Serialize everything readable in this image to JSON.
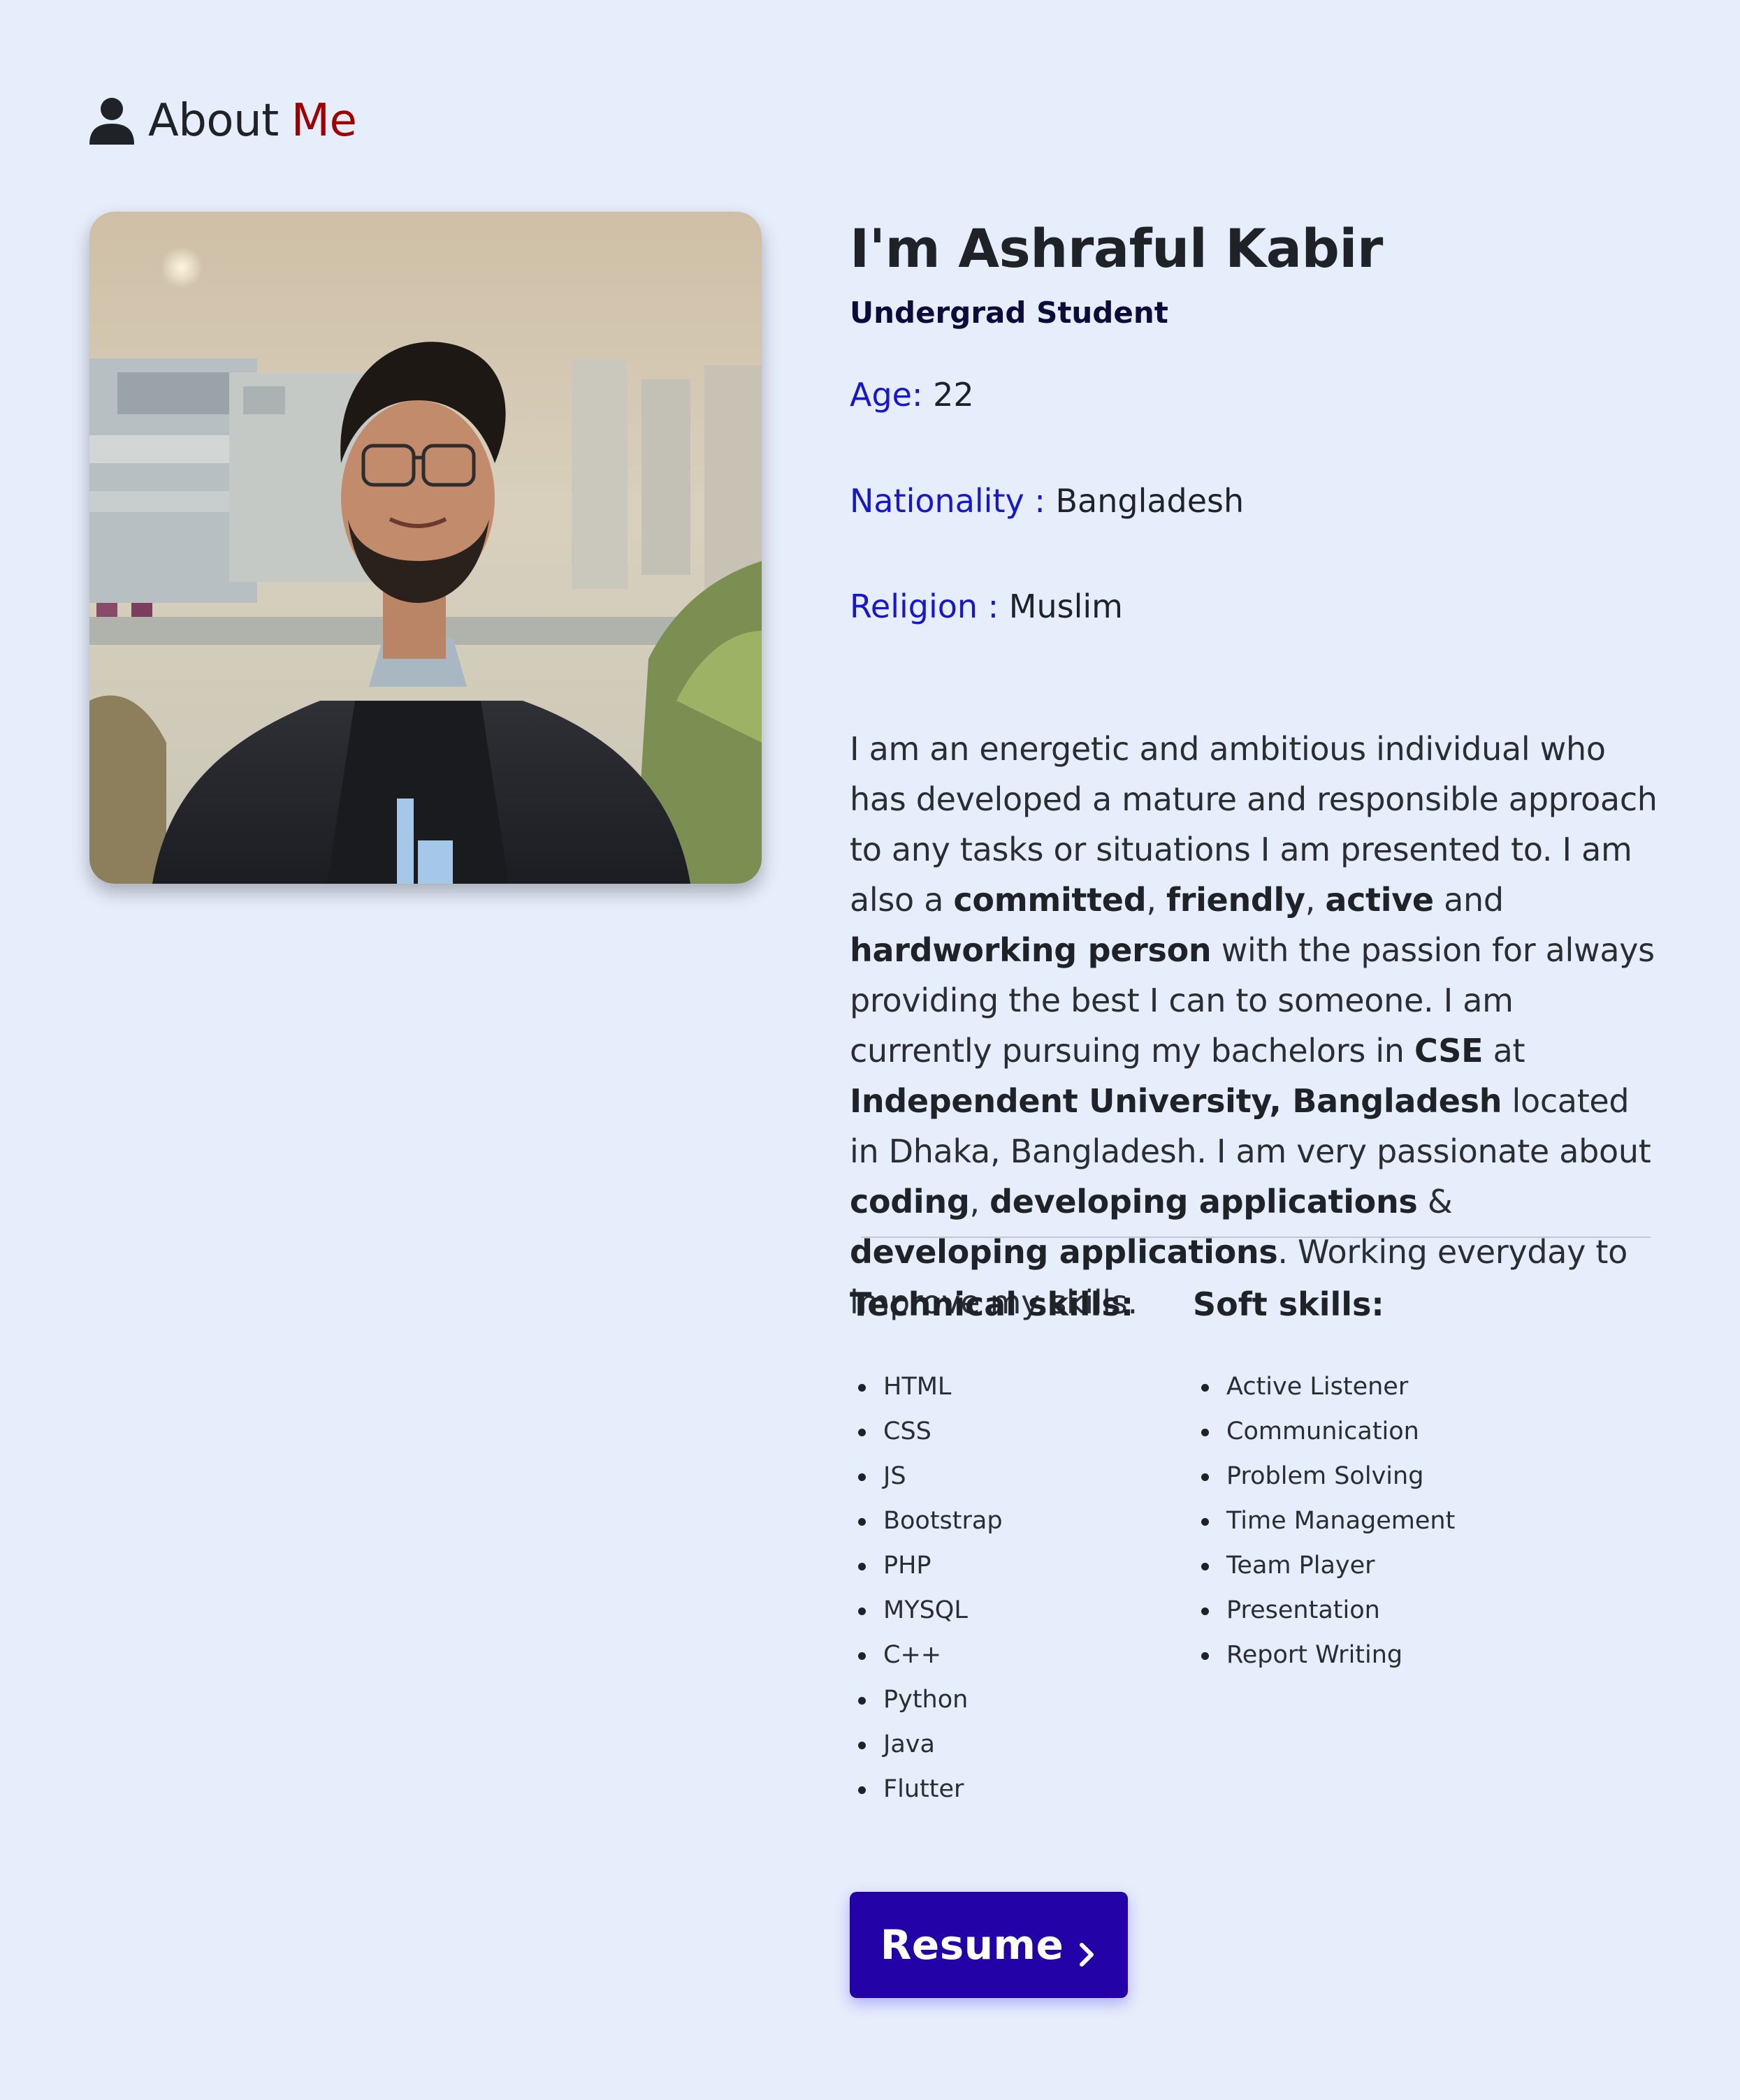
{
  "heading": {
    "icon": "user-icon",
    "about": "About",
    "me": "Me",
    "accent_color": "#a00000"
  },
  "profile": {
    "photo_alt": "profile-photo",
    "name": "I'm Ashraful Kabir",
    "subtitle": "Undergrad Student",
    "age_label": "Age:",
    "age_value": "22",
    "nationality_label": "Nationality :",
    "nationality_value": "Bangladesh",
    "religion_label": "Religion :",
    "religion_value": "Muslim",
    "label_color": "#1616d0"
  },
  "bio": {
    "p1": "I am an energetic and ambitious individual who has developed a mature and responsible approach to any tasks or situations I am presented to. I am also a ",
    "b1": "committed",
    "p2": ", ",
    "b2": "friendly",
    "p3": ", ",
    "b3": "active",
    "p4": " and ",
    "b4": "hardworking person",
    "p5": " with the passion for always providing the best I can to someone. I am currently pursuing my bachelors in ",
    "b5": "CSE",
    "p6": " at ",
    "b6": "Independent University, Bangladesh",
    "p7": " located in Dhaka, Bangladesh. I am very passionate about ",
    "b7": "coding",
    "p8": ", ",
    "b8": "developing applications",
    "p9": " & ",
    "b9": "developing applications",
    "p10": ". Working everyday to improve my skills."
  },
  "skills": {
    "technical_title": "Technical skills:",
    "technical": [
      "HTML",
      "CSS",
      "JS",
      "Bootstrap",
      "PHP",
      "MYSQL",
      "C++",
      "Python",
      "Java",
      "Flutter"
    ],
    "soft_title": "Soft skills:",
    "soft": [
      "Active Listener",
      "Communication",
      "Problem Solving",
      "Time Management",
      "Team Player",
      "Presentation",
      "Report Writing"
    ]
  },
  "resume_button": {
    "label": "Resume",
    "icon": "chevron-right-icon",
    "color": "#2303a8"
  }
}
